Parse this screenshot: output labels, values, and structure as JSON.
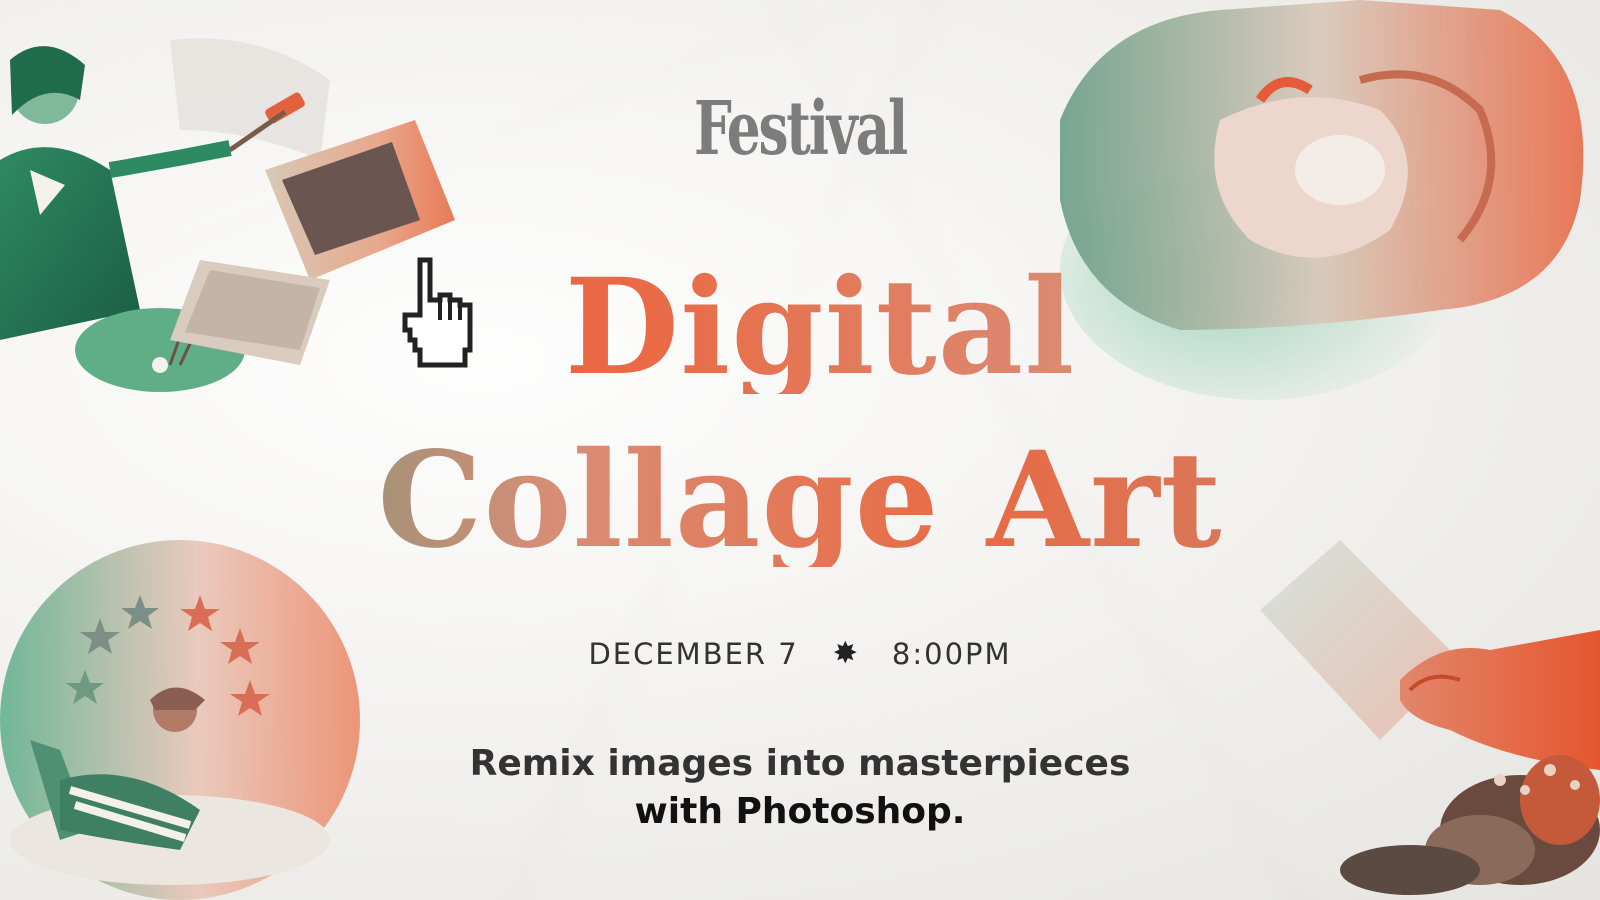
{
  "brand": "Festival",
  "title": {
    "line1": "Digital",
    "line2": "Collage Art"
  },
  "event": {
    "date": "DECEMBER 7",
    "separator_icon": "starburst-icon",
    "time": "8:00PM"
  },
  "description": {
    "line1": "Remix images into masterpieces",
    "line2": "with Photoshop."
  },
  "colors": {
    "orange": "#e54c2c",
    "green": "#3e9c7c",
    "text": "#333333"
  }
}
